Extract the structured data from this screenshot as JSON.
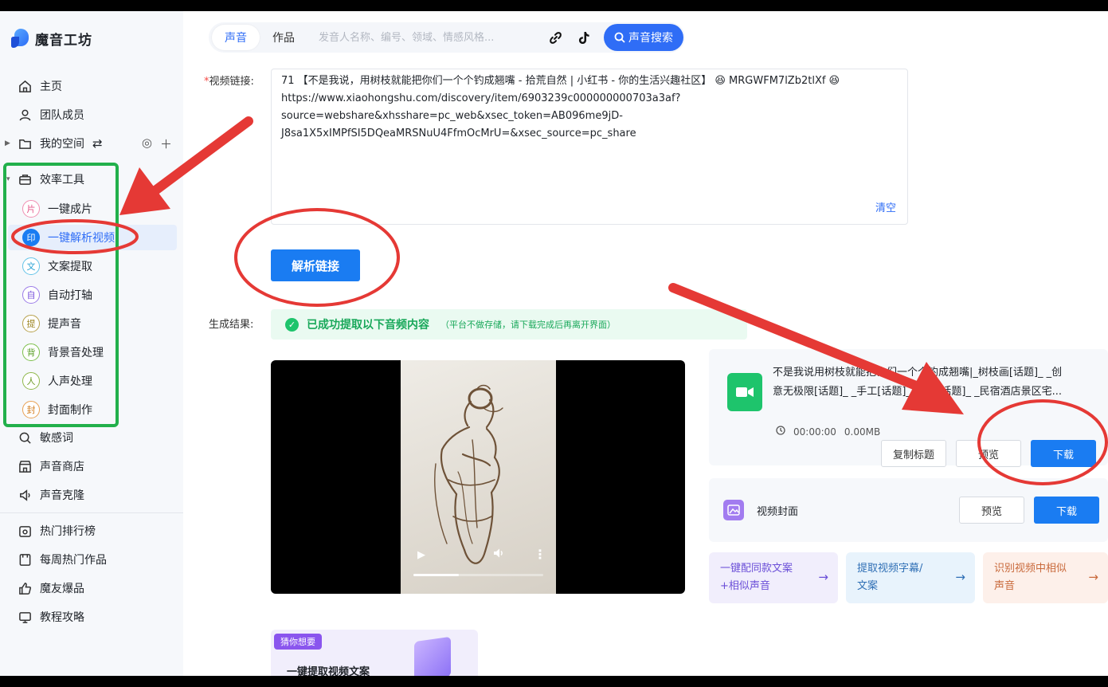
{
  "app": {
    "name": "魔音工坊"
  },
  "sidebar": {
    "items": [
      {
        "label": "主页"
      },
      {
        "label": "团队成员"
      },
      {
        "label": "我的空间"
      },
      {
        "label": "效率工具"
      }
    ],
    "tools": [
      {
        "badge": "片",
        "label": "一键成片"
      },
      {
        "badge": "印",
        "label": "一键解析视频"
      },
      {
        "badge": "文",
        "label": "文案提取"
      },
      {
        "badge": "自",
        "label": "自动打轴"
      },
      {
        "badge": "提",
        "label": "提声音"
      },
      {
        "badge": "背",
        "label": "背景音处理"
      },
      {
        "badge": "人",
        "label": "人声处理"
      },
      {
        "badge": "封",
        "label": "封面制作"
      }
    ],
    "items2": [
      {
        "label": "敏感词"
      },
      {
        "label": "声音商店"
      },
      {
        "label": "声音克隆"
      }
    ],
    "items3": [
      {
        "label": "热门排行榜"
      },
      {
        "label": "每周热门作品"
      },
      {
        "label": "魔友爆品"
      },
      {
        "label": "教程攻略"
      }
    ]
  },
  "topbar": {
    "tab_voice": "声音",
    "tab_works": "作品",
    "search_placeholder": "发音人名称、编号、领域、情感风格...",
    "search_button": "声音搜索"
  },
  "form": {
    "link_label": "视频链接:",
    "link_lines": [
      "71 【不是我说，用树枝就能把你们一个个钓成翘嘴 - 拾荒自然 | 小红书 - 你的生活兴趣社区】 😆 MRGWFM7lZb2tlXf 😆",
      "https://www.xiaohongshu.com/discovery/item/6903239c000000000703a3af?",
      "source=webshare&xhsshare=pc_web&xsec_token=AB096me9jD-",
      "J8sa1X5xIMPfSI5DQeaMRSNuU4FfmOcMrU=&xsec_source=pc_share"
    ],
    "clear": "清空",
    "parse_button": "解析链接",
    "result_label": "生成结果:",
    "success_main": "已成功提取以下音频内容",
    "success_note": "（平台不做存储，请下载完成后再离开界面）"
  },
  "player": {
    "progress": 0.35
  },
  "file": {
    "title_line1": "不是我说用树枝就能把你们一个个钓成翘嘴|_树枝画[话题]_ _创",
    "title_line2": "意无极限[话题]_ _手工[话题]_ _DIY[话题]_ _民宿酒店景区宅...",
    "duration": "00:00:00",
    "size": "0.00MB",
    "copy_title": "复制标题",
    "preview": "预览",
    "download": "下载"
  },
  "cover": {
    "label": "视频封面",
    "preview": "预览",
    "download": "下载"
  },
  "features": [
    {
      "line1": "一键配同款文案",
      "line2": "+相似声音",
      "bg": "#f1eefc",
      "fg": "#6b4fd8"
    },
    {
      "line1": "提取视频字幕/",
      "line2": "文案",
      "bg": "#e8f3fc",
      "fg": "#2f6fb5"
    },
    {
      "line1": "识别视频中相似",
      "line2": "声音",
      "bg": "#fdf0ea",
      "fg": "#c96a3c"
    }
  ],
  "guess": {
    "tag": "猜你想要",
    "text": "一键提取视频文案"
  },
  "colors": {
    "accent": "#2f6df6",
    "button": "#1a7cf2",
    "success": "#1ec46c",
    "annotation": "#e53935",
    "highlight": "#22b04b"
  }
}
